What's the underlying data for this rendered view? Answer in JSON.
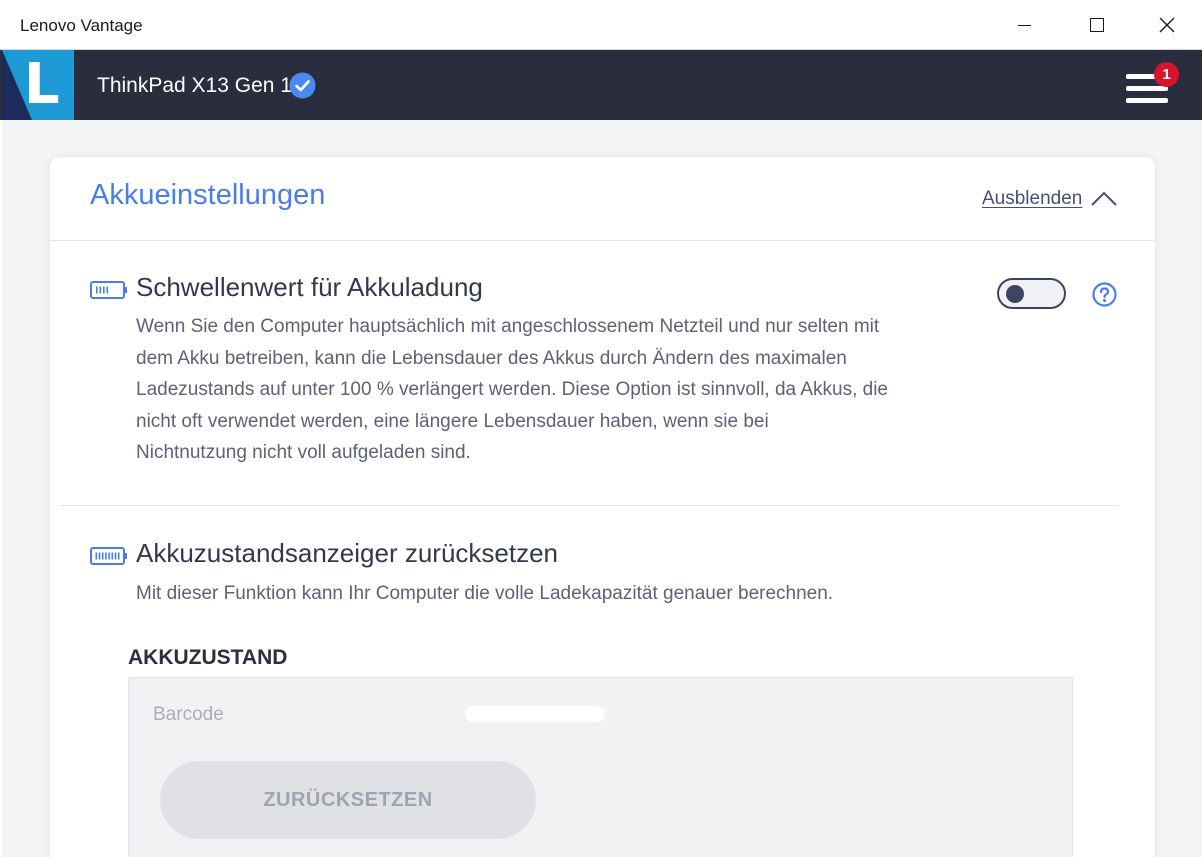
{
  "window": {
    "title": "Lenovo Vantage"
  },
  "header": {
    "logo_letter": "L",
    "device_name": "ThinkPad X13 Gen 1",
    "notification_count": "1"
  },
  "card": {
    "title": "Akkueinstellungen",
    "collapse_label": "Ausblenden",
    "threshold": {
      "title": "Schwellenwert für Akkuladung",
      "description_lines": [
        "Wenn Sie den Computer hauptsächlich mit angeschlossenem Netzteil und nur selten mit",
        "dem Akku betreiben, kann die Lebensdauer des Akkus durch Ändern des maximalen",
        "Ladezustands auf unter 100 % verlängert werden. Diese Option ist sinnvoll, da Akkus, die",
        "nicht oft verwendet werden, eine längere Lebensdauer haben, wenn sie bei",
        "Nichtnutzung nicht voll aufgeladen sind."
      ],
      "toggle_on": false
    },
    "gauge_reset": {
      "title": "Akkuzustandsanzeiger zurücksetzen",
      "description": "Mit dieser Funktion kann Ihr Computer die volle Ladekapazität genauer berechnen.",
      "status_title": "AKKUZUSTAND",
      "barcode_label": "Barcode",
      "reset_button": "ZURÜCKSETZEN"
    }
  },
  "colors": {
    "accent_blue": "#4a7ee6",
    "header_dark": "#292d3e",
    "logo_blue": "#1e9ad6",
    "badge_red": "#d9132b"
  }
}
